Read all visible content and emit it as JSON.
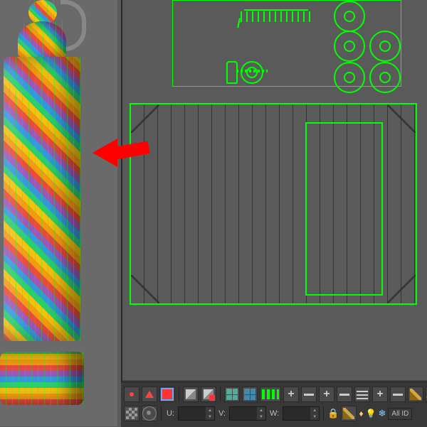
{
  "viewport3d": {
    "object_name": "fire-extinguisher",
    "texture": "uv-checker-rainbow"
  },
  "uv_editor": {
    "top_cluster": {
      "shapes": [
        "bottle-outline",
        "gear",
        "slash",
        "barcode",
        "circle-1",
        "circle-2",
        "circle-3",
        "circle-4",
        "circle-5"
      ]
    },
    "main_island": {
      "outer_rect": true,
      "inner_rect": true,
      "grid_lines": 22
    }
  },
  "toolbar": {
    "row1": {
      "vertex_mode": "·",
      "edge_mode": "△",
      "face_mode": "■",
      "element_mode": "▣",
      "plus": "+",
      "minus": "—"
    },
    "row2": {
      "u_label": "U:",
      "u_value": "",
      "v_label": "V:",
      "v_value": "",
      "w_label": "W:",
      "w_value": "",
      "allid_label": "All ID"
    }
  },
  "annotation": {
    "arrow_target": "bottle-cylinder-body",
    "arrow_color": "#ff0000"
  }
}
